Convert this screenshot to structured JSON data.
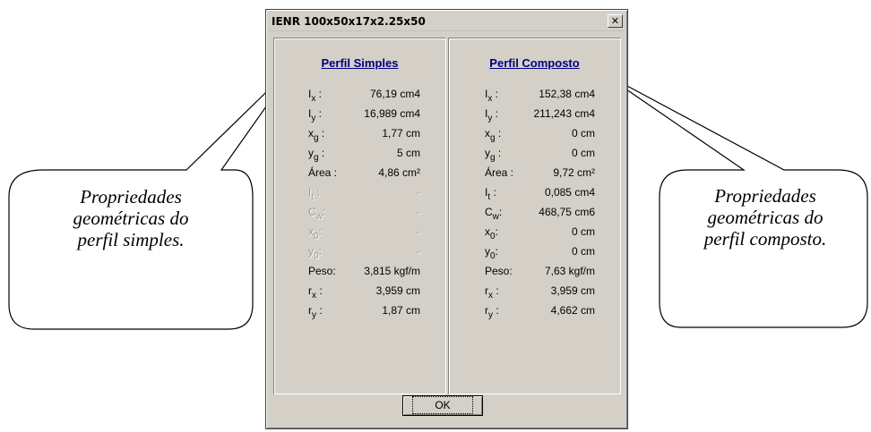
{
  "window": {
    "title": "IENR 100x50x17x2.25x50",
    "close_glyph": "✕"
  },
  "left_panel": {
    "title": "Perfil Simples",
    "rows": [
      {
        "label": "I",
        "sub": "x",
        "suffix": " :",
        "value": "76,19 cm4",
        "enabled": true
      },
      {
        "label": "I",
        "sub": "y",
        "suffix": " :",
        "value": "16,989 cm4",
        "enabled": true
      },
      {
        "label": "x",
        "sub": "g",
        "suffix": " :",
        "value": "1,77 cm",
        "enabled": true
      },
      {
        "label": "y",
        "sub": "g",
        "suffix": " :",
        "value": "5 cm",
        "enabled": true
      },
      {
        "label": "Área :",
        "sub": "",
        "suffix": "",
        "value": "4,86 cm²",
        "enabled": true
      },
      {
        "label": "I",
        "sub": "t",
        "suffix": " :",
        "value": "-",
        "enabled": false
      },
      {
        "label": "C",
        "sub": "w",
        "suffix": ":",
        "value": "-",
        "enabled": false
      },
      {
        "label": "x",
        "sub": "0",
        "suffix": ":",
        "value": "-",
        "enabled": false
      },
      {
        "label": "y",
        "sub": "0",
        "suffix": ":",
        "value": "-",
        "enabled": false
      },
      {
        "label": "Peso:",
        "sub": "",
        "suffix": "",
        "value": "3,815 kgf/m",
        "enabled": true
      },
      {
        "label": "r",
        "sub": "x",
        "suffix": " :",
        "value": "3,959 cm",
        "enabled": true
      },
      {
        "label": "r",
        "sub": "y",
        "suffix": " :",
        "value": "1,87 cm",
        "enabled": true
      }
    ]
  },
  "right_panel": {
    "title": "Perfil Composto",
    "rows": [
      {
        "label": "I",
        "sub": "x",
        "suffix": " :",
        "value": "152,38 cm4",
        "enabled": true
      },
      {
        "label": "I",
        "sub": "y",
        "suffix": " :",
        "value": "211,243 cm4",
        "enabled": true
      },
      {
        "label": "x",
        "sub": "g",
        "suffix": " :",
        "value": "0 cm",
        "enabled": true
      },
      {
        "label": "y",
        "sub": "g",
        "suffix": " :",
        "value": "0 cm",
        "enabled": true
      },
      {
        "label": "Área :",
        "sub": "",
        "suffix": "",
        "value": "9,72 cm²",
        "enabled": true
      },
      {
        "label": "I",
        "sub": "t",
        "suffix": " :",
        "value": "0,085 cm4",
        "enabled": true
      },
      {
        "label": "C",
        "sub": "w",
        "suffix": ":",
        "value": "468,75 cm6",
        "enabled": true
      },
      {
        "label": "x",
        "sub": "0",
        "suffix": ":",
        "value": "0 cm",
        "enabled": true
      },
      {
        "label": "y",
        "sub": "0",
        "suffix": ":",
        "value": "0 cm",
        "enabled": true
      },
      {
        "label": "Peso:",
        "sub": "",
        "suffix": "",
        "value": "7,63 kgf/m",
        "enabled": true
      },
      {
        "label": "r",
        "sub": "x",
        "suffix": " :",
        "value": "3,959 cm",
        "enabled": true
      },
      {
        "label": "r",
        "sub": "y",
        "suffix": " :",
        "value": "4,662 cm",
        "enabled": true
      }
    ]
  },
  "ok_button": {
    "label": "OK"
  },
  "callout_left": {
    "lines": [
      "Propriedades",
      "geométricas do",
      "perfil simples."
    ]
  },
  "callout_right": {
    "lines": [
      "Propriedades",
      "geométricas do",
      "perfil composto."
    ]
  }
}
